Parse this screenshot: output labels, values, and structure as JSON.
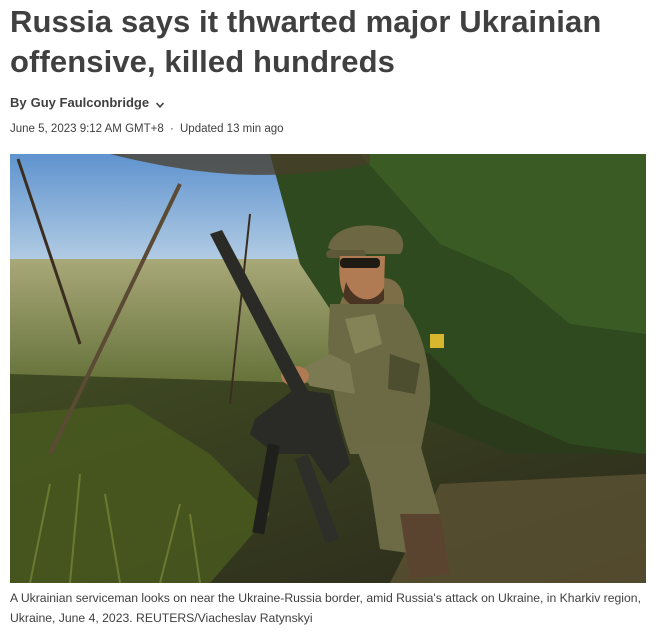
{
  "article": {
    "headline": "Russia says it thwarted major Ukrainian offensive, killed hundreds",
    "byline": {
      "prefix": "By",
      "author": "Guy Faulconbridge"
    },
    "dateline": {
      "published": "June 5, 2023 9:12 AM GMT+8",
      "separator": "·",
      "updated": "Updated 13 min ago"
    },
    "image": {
      "caption": "A Ukrainian serviceman looks on near the Ukraine-Russia border, amid Russia's attack on Ukraine, in Kharkiv region, Ukraine, June 4, 2023. REUTERS/Viacheslav Ratynskyi"
    }
  },
  "icons": {
    "byline_toggle": "chevron-down-icon"
  },
  "colors": {
    "text": "#404040",
    "background": "#ffffff"
  }
}
